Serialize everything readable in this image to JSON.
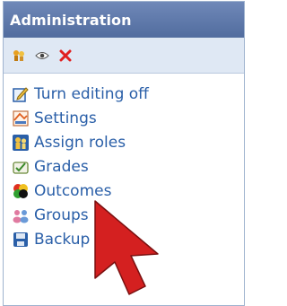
{
  "block": {
    "title": "Administration"
  },
  "toolbar": {
    "icons": [
      "assign-roles-icon",
      "eye-icon",
      "delete-icon"
    ]
  },
  "menu": {
    "items": [
      {
        "label": "Turn editing off",
        "icon": "edit-icon"
      },
      {
        "label": "Settings",
        "icon": "settings-icon"
      },
      {
        "label": "Assign roles",
        "icon": "roles-icon"
      },
      {
        "label": "Grades",
        "icon": "grades-icon"
      },
      {
        "label": "Outcomes",
        "icon": "outcomes-icon"
      },
      {
        "label": "Groups",
        "icon": "groups-icon"
      },
      {
        "label": "Backup",
        "icon": "backup-icon"
      }
    ]
  },
  "colors": {
    "header_bg": "#5f79ab",
    "link": "#2a5fa8",
    "toolbar_bg": "#dfe8f4",
    "delete": "#e02020",
    "cursor": "#d42020"
  }
}
